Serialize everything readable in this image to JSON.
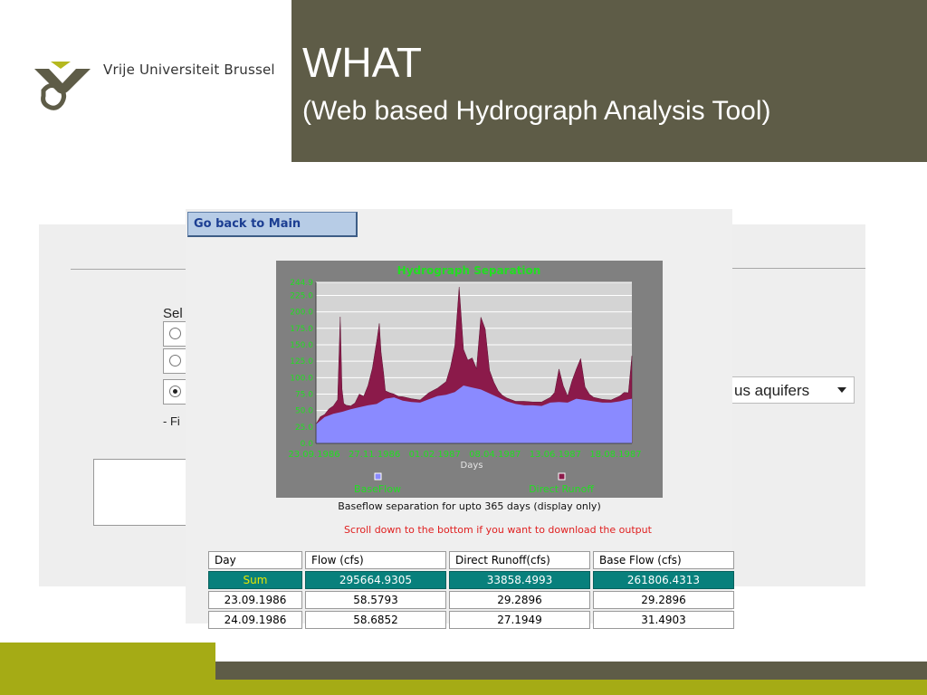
{
  "header": {
    "university": "Vrije Universiteit Brussel",
    "title": "WHAT",
    "subtitle": "(Web based Hydrograph Analysis Tool)"
  },
  "background_app": {
    "select_label": "Sel",
    "list_marker": "- Fi",
    "dropdown_value": "us aquifers"
  },
  "app": {
    "back_button": "Go back to Main",
    "chart_caption": "Baseflow separation for upto 365 days (display only)",
    "scroll_note": "Scroll down to the bottom if you want to download the output"
  },
  "table": {
    "headers": [
      "Day",
      "Flow (cfs)",
      "Direct Runoff(cfs)",
      "Base Flow (cfs)"
    ],
    "sum_row": [
      "Sum",
      "295664.9305",
      "33858.4993",
      "261806.4313"
    ],
    "rows": [
      [
        "23.09.1986",
        "58.5793",
        "29.2896",
        "29.2896"
      ],
      [
        "24.09.1986",
        "58.6852",
        "27.1949",
        "31.4903"
      ]
    ]
  },
  "colors": {
    "title_bg": "#5e5c47",
    "accent_green": "#a5ab15",
    "chart_text": "#22dd22",
    "baseflow": "#8a8aff",
    "direct_runoff": "#8b1a4a",
    "sum_row": "#08807c"
  },
  "chart_data": {
    "type": "area",
    "title": "Hydrograph Separation",
    "xlabel": "Days",
    "ylabel": "",
    "ylim": [
      0,
      244.9
    ],
    "y_ticks": [
      "244.9",
      "225.0",
      "200.0",
      "175.0",
      "150.0",
      "125.0",
      "100.0",
      "75.0",
      "50.0",
      "25.0",
      "0.0"
    ],
    "x_ticks": [
      "23.09.1986",
      "27.11.1986",
      "01.02.1987",
      "08.04.1987",
      "13.06.1987",
      "18.08.1987"
    ],
    "legend": [
      "BaseFlow",
      "Direct Runoff"
    ],
    "legend_position": "bottom",
    "series": [
      {
        "name": "BaseFlow",
        "x_day": [
          0,
          10,
          20,
          30,
          40,
          50,
          60,
          70,
          80,
          90,
          100,
          110,
          120,
          130,
          140,
          150,
          160,
          170,
          180,
          190,
          200,
          210,
          220,
          230,
          240,
          250,
          260,
          270,
          280,
          290,
          300,
          310,
          320,
          330,
          340,
          350,
          360,
          364
        ],
        "values": [
          29,
          40,
          45,
          48,
          52,
          55,
          58,
          60,
          68,
          70,
          65,
          63,
          62,
          67,
          72,
          74,
          78,
          88,
          85,
          82,
          76,
          70,
          64,
          60,
          58,
          58,
          57,
          62,
          63,
          62,
          68,
          66,
          64,
          62,
          62,
          64,
          67,
          68
        ]
      },
      {
        "name": "Direct Runoff",
        "x_day": [
          0,
          5,
          10,
          15,
          20,
          25,
          28,
          30,
          32,
          35,
          40,
          45,
          50,
          55,
          60,
          65,
          70,
          73,
          75,
          78,
          80,
          85,
          90,
          95,
          100,
          110,
          120,
          130,
          140,
          150,
          155,
          160,
          165,
          170,
          175,
          180,
          185,
          190,
          195,
          200,
          205,
          210,
          215,
          220,
          230,
          240,
          250,
          260,
          270,
          275,
          280,
          285,
          290,
          295,
          300,
          305,
          310,
          315,
          320,
          330,
          340,
          350,
          355,
          360,
          364
        ],
        "values": [
          0,
          6,
          4,
          10,
          12,
          20,
          145,
          35,
          12,
          8,
          5,
          8,
          20,
          15,
          30,
          55,
          95,
          120,
          75,
          40,
          12,
          8,
          5,
          4,
          6,
          5,
          4,
          10,
          12,
          20,
          40,
          70,
          155,
          55,
          40,
          45,
          30,
          110,
          95,
          35,
          20,
          10,
          6,
          5,
          4,
          6,
          5,
          6,
          8,
          15,
          50,
          25,
          10,
          30,
          45,
          62,
          20,
          10,
          6,
          5,
          4,
          8,
          12,
          10,
          65
        ]
      }
    ]
  }
}
